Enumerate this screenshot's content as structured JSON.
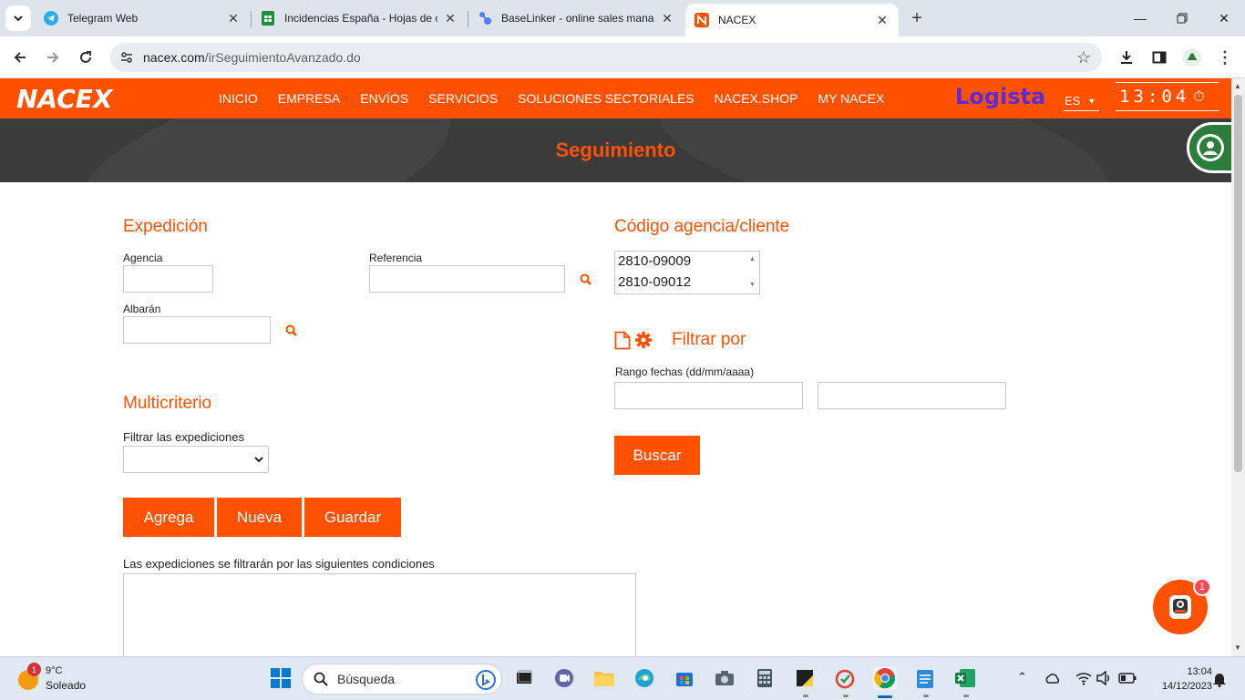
{
  "browser": {
    "tabs": [
      {
        "title": "Telegram Web",
        "icon": "telegram-icon",
        "color": "#2aabee"
      },
      {
        "title": "Incidencias España - Hojas de cálculo",
        "icon": "sheets-icon",
        "color": "#1e8e3e"
      },
      {
        "title": "BaseLinker - online sales manager",
        "icon": "baselinker-icon",
        "color": "#4d7cfe"
      },
      {
        "title": "NACEX",
        "icon": "nacex-icon",
        "color": "#ff5100"
      }
    ],
    "url_host": "nacex.com",
    "url_path": "/irSeguimientoAvanzado.do"
  },
  "site": {
    "logo": "NACEX",
    "nav": [
      "INICIO",
      "EMPRESA",
      "ENVÍOS",
      "SERVICIOS",
      "SOLUCIONES SECTORIALES",
      "NACEX.SHOP",
      "MY NACEX"
    ],
    "partner": "Logista",
    "language": "ES",
    "clock": "13:04"
  },
  "hero": {
    "title": "Seguimiento"
  },
  "expedicion": {
    "heading": "Expedición",
    "agencia_label": "Agencia",
    "referencia_label": "Referencia",
    "albaran_label": "Albarán"
  },
  "codigo": {
    "heading": "Código agencia/cliente",
    "options": [
      "2810-09009",
      "2810-09012"
    ]
  },
  "filtrar": {
    "heading": "Filtrar por",
    "rango_label": "Rango fechas (dd/mm/aaaa)",
    "buscar": "Buscar"
  },
  "multicriterio": {
    "heading": "Multicriterio",
    "filtrar_label": "Filtrar las expediciones",
    "buttons": [
      "Agrega",
      "Nueva",
      "Guardar"
    ],
    "conditions_label": "Las expediciones se filtrarán por las siguientes condiciones"
  },
  "chat": {
    "badge": "1"
  },
  "taskbar": {
    "weather_temp": "9°C",
    "weather_cond": "Soleado",
    "weather_badge": "1",
    "search_placeholder": "Búsqueda",
    "time": "13:04",
    "date": "14/12/2023"
  },
  "colors": {
    "brand": "#ff5100",
    "hero": "#3b3b3b",
    "partner": "#5c2bd6"
  }
}
